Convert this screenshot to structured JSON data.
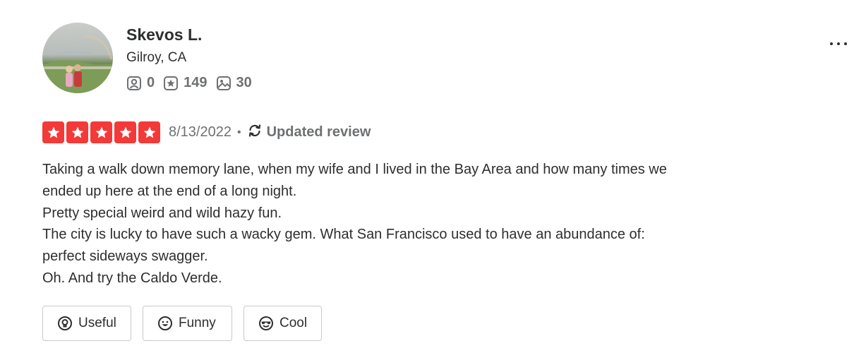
{
  "user": {
    "name": "Skevos L.",
    "location": "Gilroy, CA",
    "stats": {
      "friends": "0",
      "reviews": "149",
      "photos": "30"
    }
  },
  "icons": {
    "friends": "friends-icon",
    "reviews": "review-star-icon",
    "photos": "photo-icon",
    "updated": "refresh-icon",
    "more": "more-dots-icon"
  },
  "review": {
    "rating": 5,
    "max_rating": 5,
    "date": "8/13/2022",
    "separator": "•",
    "updated_label": "Updated review",
    "lines": [
      "Taking a walk down memory lane, when my wife and I lived in the Bay Area and how many times we",
      "ended up here at the end of a long night.",
      "Pretty special weird and wild hazy fun.",
      "The city is lucky to have such a wacky gem. What San Francisco used to have an abundance of:",
      "perfect sideways swagger.",
      "Oh. And try the Caldo Verde."
    ]
  },
  "reactions": {
    "useful": "Useful",
    "funny": "Funny",
    "cool": "Cool"
  },
  "colors": {
    "star_red": "#f43939",
    "text": "#2d2e2f",
    "muted": "#6e7072",
    "border": "#c8c9ca"
  }
}
